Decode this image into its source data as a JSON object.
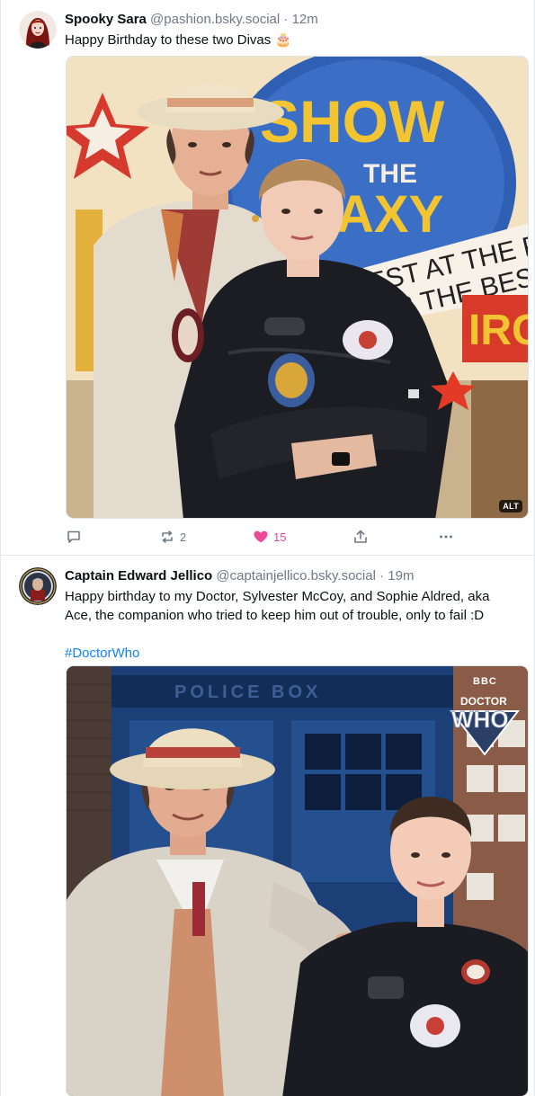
{
  "posts": [
    {
      "author": {
        "display_name": "Spooky Sara",
        "handle": "@pashion.bsky.social",
        "avatar_icon": "avatar-red-haired-woman"
      },
      "separator": "·",
      "time": "12m",
      "text": "Happy Birthday to these two Divas 🎂",
      "media": {
        "alt_label": "ALT",
        "scene": "man-in-straw-hat-and-woman-in-bomber-jacket-before-circus-poster",
        "poster_text_lines": [
          "SHOW",
          "THE",
          "AXY",
          "EST AT THE PLA",
          "OR THE BES",
          "IRC"
        ]
      },
      "actions": {
        "reply_count": "",
        "repost_count": "2",
        "like_count": "15",
        "liked": true
      }
    },
    {
      "author": {
        "display_name": "Captain Edward Jellico",
        "handle": "@captainjellico.bsky.social",
        "avatar_icon": "avatar-starfleet-captain"
      },
      "separator": "·",
      "time": "19m",
      "text": "Happy birthday to my Doctor, Sylvester McCoy, and Sophie Aldred, aka Ace, the companion who tried to keep him out of trouble, only to fail :D",
      "hashtag": "#DoctorWho",
      "media": {
        "scene": "man-in-straw-hat-and-woman-in-bomber-jacket-before-blue-police-box",
        "police_box_text": "POLICE BOX",
        "logo_top": "BBC",
        "logo_line1": "DOCTOR",
        "logo_line2": "WHO"
      }
    }
  ],
  "colors": {
    "text": "#0b0f14",
    "muted": "#6f7985",
    "link": "#1083fe",
    "like": "#ec4899",
    "divider": "#e3e6ea"
  }
}
